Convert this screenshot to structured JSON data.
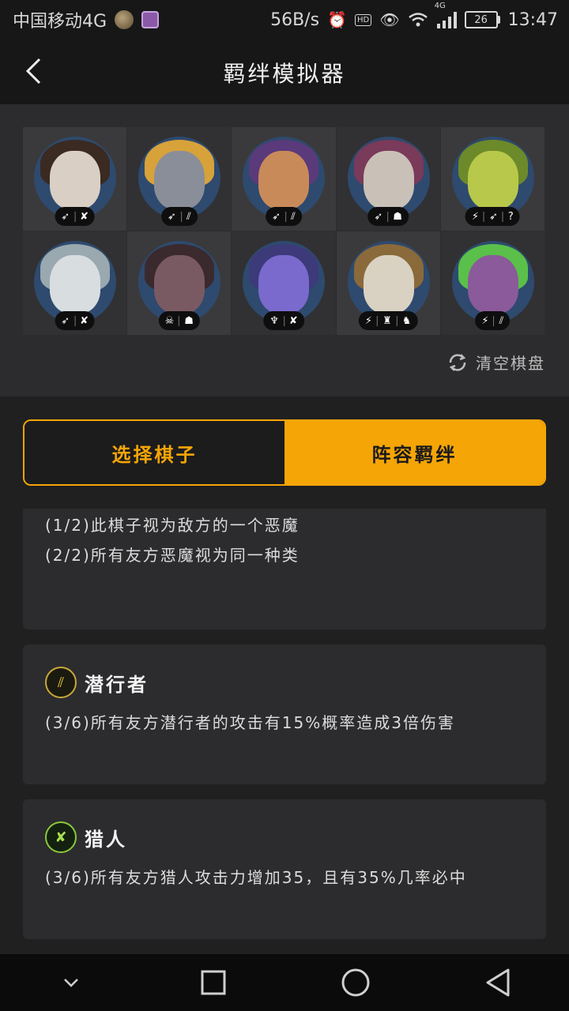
{
  "status_bar": {
    "carrier": "中国移动4G",
    "speed": "56B/s",
    "hd": "HD",
    "network": "4G",
    "battery": "26",
    "time": "13:47"
  },
  "header": {
    "title": "羁绊模拟器",
    "back_icon": "chevron-left-icon"
  },
  "board": {
    "pieces": [
      {
        "row": 1,
        "col": 1,
        "portrait_color": "#d9cfc4",
        "accent_color": "#3a2a22",
        "badges": [
          "➶",
          "✘"
        ]
      },
      {
        "row": 1,
        "col": 2,
        "portrait_color": "#8a8e99",
        "accent_color": "#d8a23a",
        "badges": [
          "➶",
          "⫽"
        ]
      },
      {
        "row": 1,
        "col": 3,
        "portrait_color": "#c98a5a",
        "accent_color": "#5a3a7a",
        "badges": [
          "➶",
          "⫽"
        ]
      },
      {
        "row": 1,
        "col": 4,
        "portrait_color": "#c9c1b8",
        "accent_color": "#7a3a5a",
        "badges": [
          "➶",
          "☗"
        ]
      },
      {
        "row": 1,
        "col": 5,
        "portrait_color": "#b8c84a",
        "accent_color": "#6c8a2a",
        "badges": [
          "⚡",
          "➶",
          "?"
        ]
      },
      {
        "row": 2,
        "col": 1,
        "portrait_color": "#d8dde0",
        "accent_color": "#9aa8b0",
        "badges": [
          "➶",
          "✘"
        ]
      },
      {
        "row": 2,
        "col": 2,
        "portrait_color": "#7a5a62",
        "accent_color": "#3a2a2e",
        "badges": [
          "☠",
          "☗"
        ]
      },
      {
        "row": 2,
        "col": 3,
        "portrait_color": "#7a6acd",
        "accent_color": "#3d3a7a",
        "badges": [
          "♆",
          "✘"
        ]
      },
      {
        "row": 2,
        "col": 4,
        "portrait_color": "#d9d2c2",
        "accent_color": "#8a6a3a",
        "badges": [
          "⚡",
          "♜",
          "♞"
        ]
      },
      {
        "row": 2,
        "col": 5,
        "portrait_color": "#8a5a9a",
        "accent_color": "#5ac04a",
        "badges": [
          "⚡",
          "⫽"
        ]
      }
    ]
  },
  "clear_button": {
    "label": "清空棋盘",
    "icon": "refresh-icon"
  },
  "tabs": [
    {
      "label": "选择棋子",
      "active": false
    },
    {
      "label": "阵容羁绊",
      "active": true
    }
  ],
  "synergies": [
    {
      "title": "",
      "icon": "demon-icon",
      "icon_color": "#8a3aa8",
      "lines": [
        "(1/2)此棋子视为敌方的一个恶魔",
        "(2/2)所有友方恶魔视为同一种类"
      ]
    },
    {
      "title": "潜行者",
      "icon": "assassin-icon",
      "icon_color": "#c8a838",
      "lines": [
        "(3/6)所有友方潜行者的攻击有15%概率造成3倍伤害"
      ]
    },
    {
      "title": "猎人",
      "icon": "hunter-icon",
      "icon_color": "#8ac83a",
      "lines": [
        "(3/6)所有友方猎人攻击力增加35，且有35%几率必中"
      ]
    }
  ],
  "nav": [
    "chevron-down-icon",
    "square-icon",
    "circle-icon",
    "triangle-back-icon"
  ]
}
